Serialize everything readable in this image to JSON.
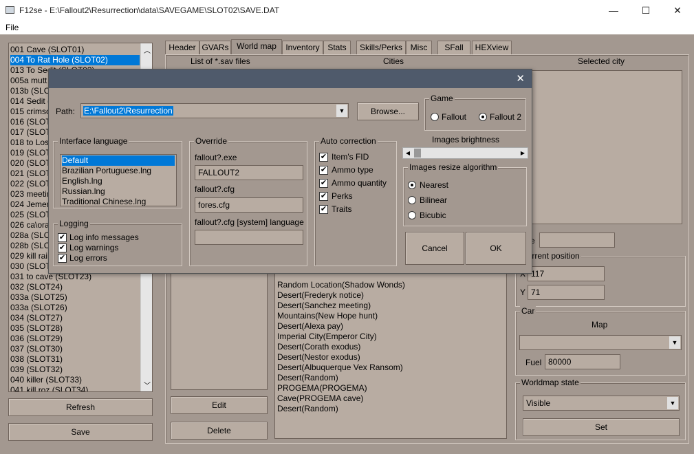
{
  "window": {
    "title": "F12se - E:\\Fallout2\\Resurrection\\data\\SAVEGAME\\SLOT02\\SAVE.DAT",
    "minimize": "—",
    "maximize": "☐",
    "close": "✕"
  },
  "menu": {
    "file": "File"
  },
  "slots": [
    "001 Cave (SLOT01)",
    "004 To Rat Hole (SLOT02)",
    "013 To Sedit (SLOT03)",
    "005a mutt",
    "013b (SLOT",
    "014 Sedit (",
    "015 crimso",
    "016 (SLOT",
    "017 (SLOT",
    "018 to Los",
    "019 (SLOT",
    "020 (SLOT",
    "021 (SLOT",
    "022 (SLOT",
    "023 meetin",
    "024 Jemery",
    "025 (SLOT",
    "026 ca\\ora",
    "028a (SLOT",
    "028b (SLOT",
    "029 kill rai",
    "030 (SLOT",
    "031 to cave (SLOT23)",
    "032 (SLOT24)",
    "033a (SLOT25)",
    "033a (SLOT26)",
    "034 (SLOT27)",
    "035 (SLOT28)",
    "036 (SLOT29)",
    "037 (SLOT30)",
    "038 (SLOT31)",
    "039 (SLOT32)",
    "040 killer (SLOT33)",
    "041 kill roz (SLOT34)"
  ],
  "selected_slot_index": 1,
  "left_buttons": {
    "refresh": "Refresh",
    "save": "Save"
  },
  "tabs": [
    "Header",
    "GVARs",
    "World map",
    "Inventory",
    "Stats",
    "Skills/Perks",
    "Misc",
    "SFall",
    "HEXview"
  ],
  "active_tab": 2,
  "worldmap": {
    "col_sav": "List of *.sav files",
    "col_cities": "Cities",
    "col_selected": "Selected city",
    "cities": [
      "Random Location(Shadow Wonds)",
      "Desert(Frederyk notice)",
      "Desert(Sanchez meeting)",
      "Mountains(New Hope hunt)",
      "Desert(Alexa pay)",
      "Imperial City(Emperor City)",
      "Desert(Corath exodus)",
      "Desert(Nestor exodus)",
      "Desert(Albuquerque Vex Ransom)",
      "Desert(Random)",
      "PROGEMA(PROGEMA)",
      "Cave(PROGEMA cave)",
      "Desert(Random)"
    ],
    "edit": "Edit",
    "delete": "Delete",
    "name_label_partial": "e",
    "current_position": "Current position",
    "x_label": "X",
    "x_value": "117",
    "y_label": "Y",
    "y_value": "71",
    "car": "Car",
    "map_label": "Map",
    "map_value": "",
    "fuel_label": "Fuel",
    "fuel_value": "80000",
    "worldmap_state": "Worldmap state",
    "state_value": "Visible",
    "set": "Set"
  },
  "dialog": {
    "close": "✕",
    "path_label": "Path:",
    "path_value": "E:\\Fallout2\\Resurrection",
    "browse": "Browse...",
    "game": "Game",
    "game_fallout": "Fallout",
    "game_fallout2": "Fallout 2",
    "interface_language": "Interface language",
    "languages": [
      "Default",
      "Brazilian Portuguese.lng",
      "English.lng",
      "Russian.lng",
      "Traditional Chinese.lng"
    ],
    "override": "Override",
    "exe_label": "fallout?.exe",
    "exe_value": "FALLOUT2",
    "cfg_label": "fallout?.cfg",
    "cfg_value": "fores.cfg",
    "syslang_label": "fallout?.cfg [system] language",
    "syslang_value": "",
    "auto_correction": "Auto correction",
    "auto_items": [
      "Item's FID",
      "Ammo type",
      "Ammo quantity",
      "Perks",
      "Traits"
    ],
    "brightness": "Images brightness",
    "resize_algo": "Images resize algorithm",
    "resize_options": [
      "Nearest",
      "Bilinear",
      "Bicubic"
    ],
    "logging": "Logging",
    "log_items": [
      "Log info messages",
      "Log warnings",
      "Log errors"
    ],
    "cancel": "Cancel",
    "ok": "OK"
  }
}
